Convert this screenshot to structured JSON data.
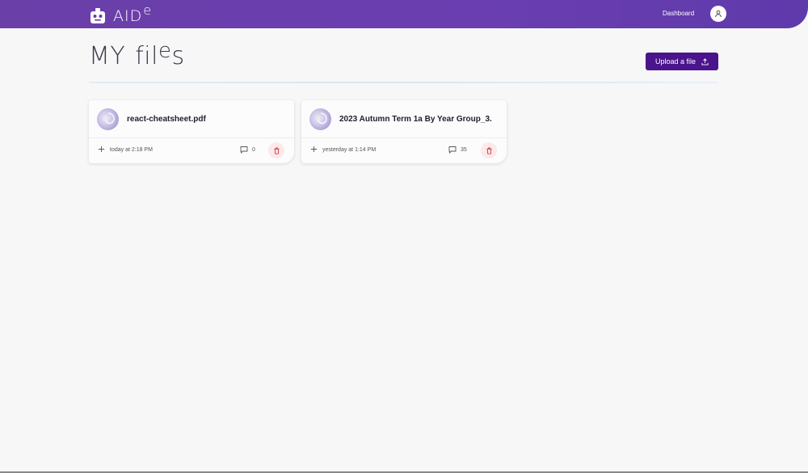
{
  "app": {
    "logo_text": "AID",
    "logo_sup": "e"
  },
  "nav": {
    "dashboard_label": "Dashboard"
  },
  "page": {
    "title_part1": "MY",
    "title_part2": "fil",
    "title_part3": "e",
    "title_part4": "s"
  },
  "toolbar": {
    "upload_label": "Upload a file"
  },
  "files": [
    {
      "name": "react-cheatsheet.pdf",
      "date": "today at 2:18 PM",
      "comments": "0"
    },
    {
      "name": "2023 Autumn Term 1a By Year Group_3.",
      "date": "yesterday at 1:14 PM",
      "comments": "35"
    }
  ],
  "colors": {
    "navbar": "#6b3fa8",
    "primary_button": "#4a148c",
    "delete_bg": "#fde8ea",
    "delete_icon": "#c62828"
  },
  "icons": {
    "logo": "robot-icon",
    "user": "user-icon",
    "upload": "upload-icon",
    "add": "plus-icon",
    "comments": "comment-icon",
    "delete": "trash-icon",
    "file": "file-thumbnail-icon"
  }
}
